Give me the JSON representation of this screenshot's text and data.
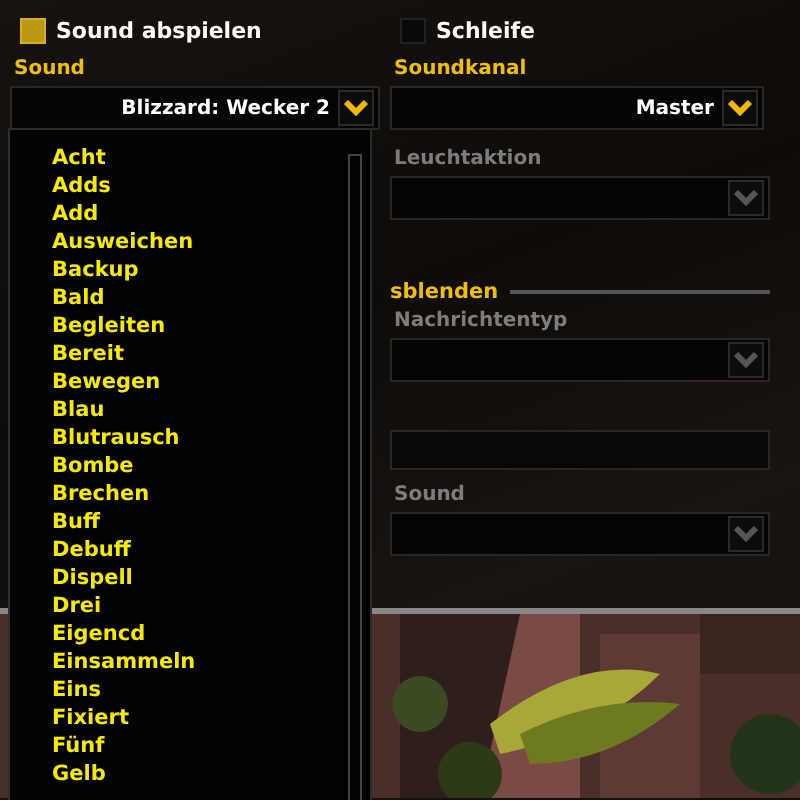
{
  "checkboxes": [
    {
      "label": "Sound abspielen",
      "checked": true
    },
    {
      "label": "Schleife",
      "checked": false
    }
  ],
  "sound": {
    "label": "Sound",
    "value": "Blizzard: Wecker 2"
  },
  "channel": {
    "label": "Soundkanal",
    "value": "Master"
  },
  "sound_list": {
    "items": [
      "Acht",
      "Adds",
      "Add",
      "Ausweichen",
      "Backup",
      "Bald",
      "Begleiten",
      "Bereit",
      "Bewegen",
      "Blau",
      "Blutrausch",
      "Bombe",
      "Brechen",
      "Buff",
      "Debuff",
      "Dispell",
      "Drei",
      "Eigencd",
      "Einsammeln",
      "Eins",
      "Fixiert",
      "Fünf",
      "Gelb"
    ]
  },
  "glow": {
    "label": "Leuchtaktion",
    "disabled": true
  },
  "section": {
    "title": "sblenden"
  },
  "message_type": {
    "label": "Nachrichtentyp",
    "disabled": true
  },
  "message_sound": {
    "label": "Sound",
    "disabled": true
  }
}
